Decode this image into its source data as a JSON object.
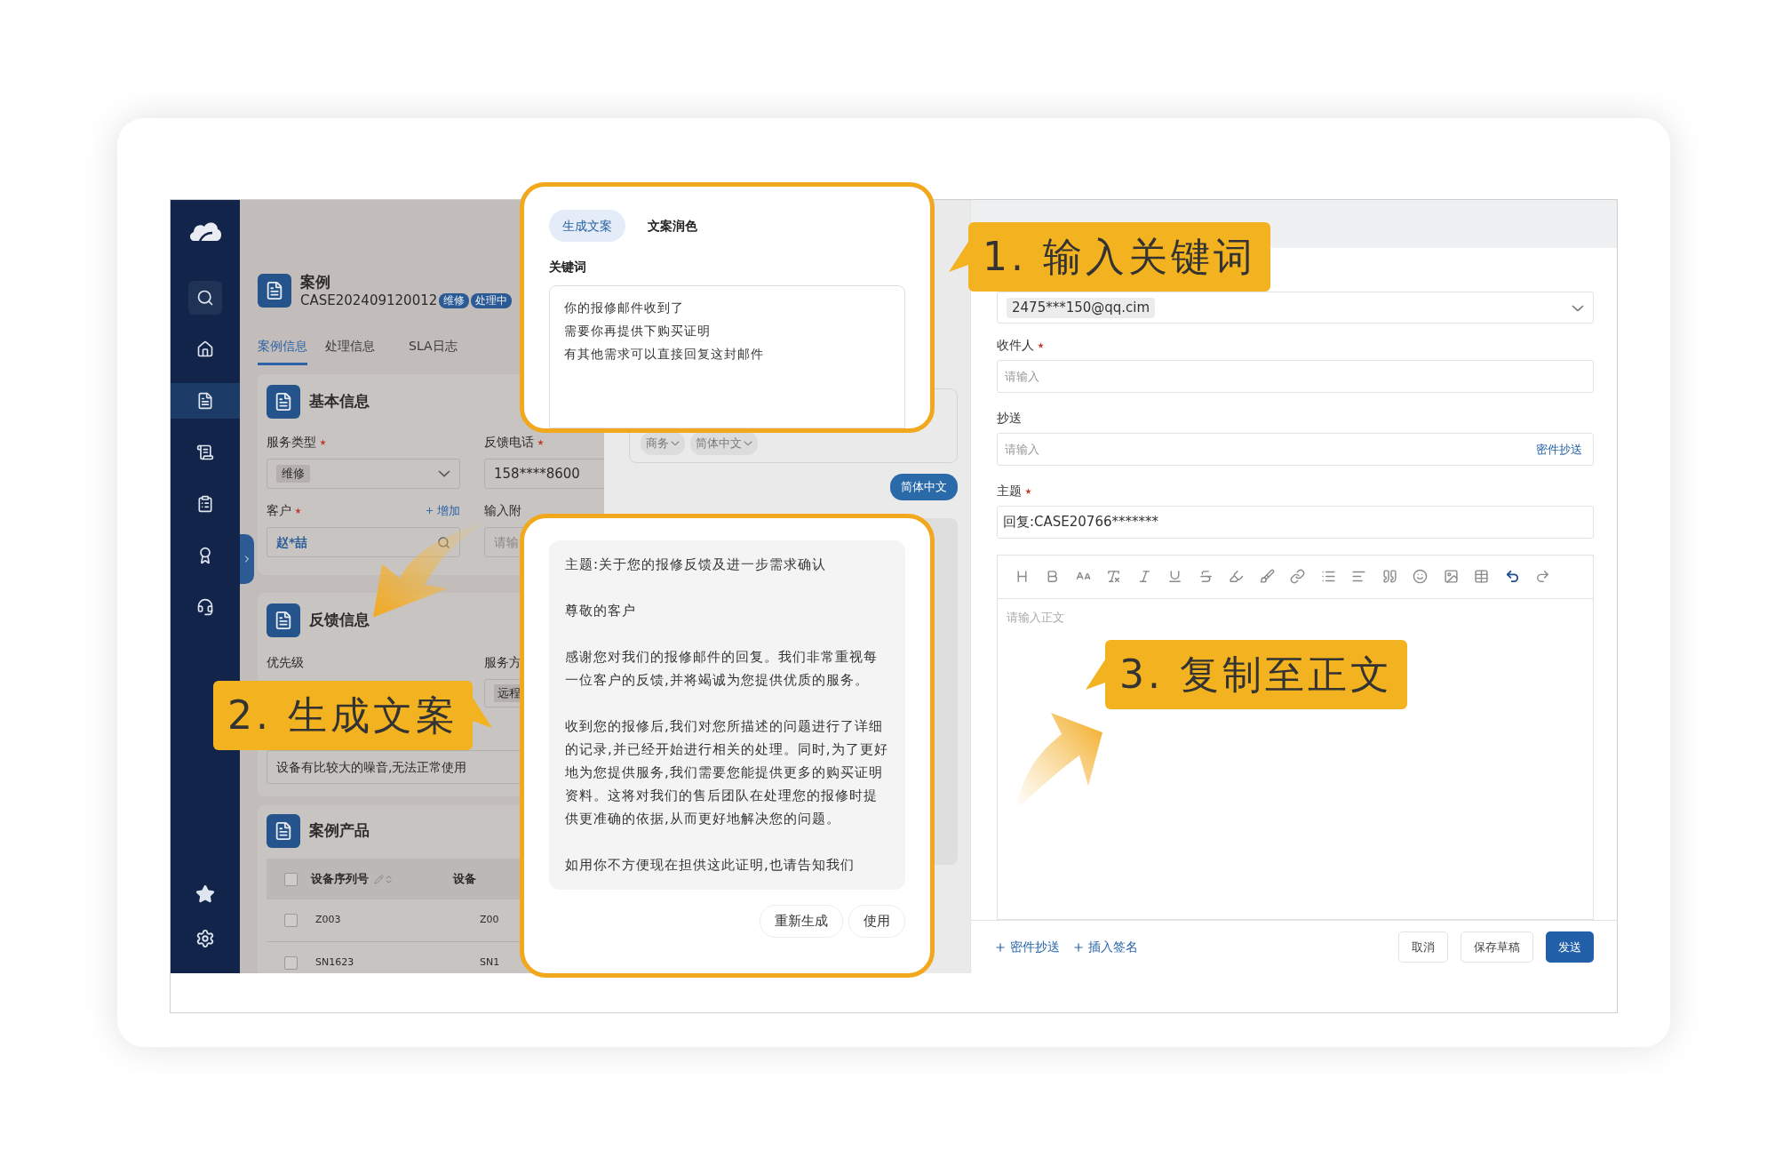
{
  "sidebar": {
    "items": [
      {
        "kind": "search",
        "selected": false
      },
      {
        "kind": "home",
        "selected": false
      },
      {
        "kind": "document",
        "selected": true
      },
      {
        "kind": "list",
        "selected": false
      },
      {
        "kind": "clipboard",
        "selected": false
      },
      {
        "kind": "award",
        "selected": false
      },
      {
        "kind": "support",
        "selected": false
      }
    ],
    "bottom": [
      {
        "kind": "star"
      },
      {
        "kind": "settings"
      }
    ]
  },
  "case": {
    "title": "案例",
    "number": "CASE202409120012",
    "tags": [
      "维修",
      "处理中"
    ]
  },
  "tabs": [
    {
      "label": "案例信息",
      "selected": true
    },
    {
      "label": "处理信息",
      "selected": false
    },
    {
      "label": "SLA日志",
      "selected": false
    }
  ],
  "basic_info": {
    "title": "基本信息",
    "service_type": {
      "label": "服务类型",
      "required": true,
      "value": "维修"
    },
    "phone": {
      "label": "反馈电话",
      "required": true,
      "value": "158****8600"
    },
    "customer": {
      "label": "客户",
      "required": true,
      "add_link": "增加",
      "value": "赵*喆"
    },
    "nearby": {
      "label": "输入附",
      "placeholder": "请输"
    }
  },
  "feedback_info": {
    "title": "反馈信息",
    "priority": {
      "label": "优先级"
    },
    "service_party": {
      "label": "服务方",
      "value": "远程"
    },
    "description": "设备有比较大的噪音,无法正常使用"
  },
  "products": {
    "title": "案例产品",
    "select_all_checked": false,
    "columns": [
      "设备序列号",
      "设备"
    ],
    "rows": [
      {
        "checked": false,
        "cells": [
          "Z003",
          "Z00"
        ]
      },
      {
        "checked": false,
        "cells": [
          "SN1623",
          "SN1"
        ]
      }
    ]
  },
  "middle": {
    "chips": [
      "商务",
      "简体中文"
    ],
    "language_button": "简体中文"
  },
  "keyword_popup": {
    "tabs": [
      {
        "label": "生成文案",
        "selected": true
      },
      {
        "label": "文案润色",
        "selected": false
      }
    ],
    "label": "关键词",
    "lines": [
      "你的报修邮件收到了",
      "需要你再提供下购买证明",
      "有其他需求可以直接回复这封邮件"
    ]
  },
  "result_popup": {
    "paragraphs": [
      "主题:关于您的报修反馈及进一步需求确认",
      "尊敬的客户",
      "感谢您对我们的报修邮件的回复。我们非常重视每一位客户的反馈,并将竭诚为您提供优质的服务。",
      "收到您的报修后,我们对您所描述的问题进行了详细的记录,并已经开始进行相关的处理。同时,为了更好地为您提供服务,我们需要您能提供更多的购买证明资料。这将对我们的售后团队在处理您的报修时提供更准确的依据,从而更好地解决您的问题。",
      "如用你不方便现在担供这此证明,也请告知我们"
    ],
    "buttons": [
      "重新生成",
      "使用"
    ]
  },
  "email": {
    "from": "2475***150@qq.cim",
    "recipients": {
      "label": "收件人",
      "required": true,
      "placeholder": "请输入"
    },
    "cc": {
      "label": "抄送",
      "placeholder": "请输入",
      "link": "密件抄送"
    },
    "subject": {
      "label": "主题",
      "required": true,
      "value": "回复:CASE20766*******"
    },
    "toolbar": [
      {
        "kind": "heading",
        "active": false
      },
      {
        "kind": "bold",
        "active": false
      },
      {
        "kind": "font-size",
        "active": false
      },
      {
        "kind": "clear-format",
        "active": false
      },
      {
        "kind": "italic",
        "active": false
      },
      {
        "kind": "underline",
        "active": false
      },
      {
        "kind": "strikethrough",
        "active": false
      },
      {
        "kind": "highlight",
        "active": false
      },
      {
        "kind": "brush",
        "active": false
      },
      {
        "kind": "link",
        "active": false
      },
      {
        "kind": "bullet-list",
        "active": false
      },
      {
        "kind": "align",
        "active": false
      },
      {
        "kind": "quote",
        "active": false
      },
      {
        "kind": "emoji",
        "active": false
      },
      {
        "kind": "image",
        "active": false
      },
      {
        "kind": "table",
        "active": false
      },
      {
        "kind": "undo",
        "active": true
      },
      {
        "kind": "redo",
        "active": false
      }
    ],
    "body_placeholder": "请输入正文",
    "footer_links": [
      "密件抄送",
      "插入签名"
    ],
    "buttons": [
      {
        "label": "取消",
        "kind": "default"
      },
      {
        "label": "保存草稿",
        "kind": "default"
      },
      {
        "label": "发送",
        "kind": "primary"
      }
    ]
  },
  "callouts": [
    {
      "label": "1. 输入关键词"
    },
    {
      "label": "2. 生成文案"
    },
    {
      "label": "3. 复制至正文"
    }
  ]
}
